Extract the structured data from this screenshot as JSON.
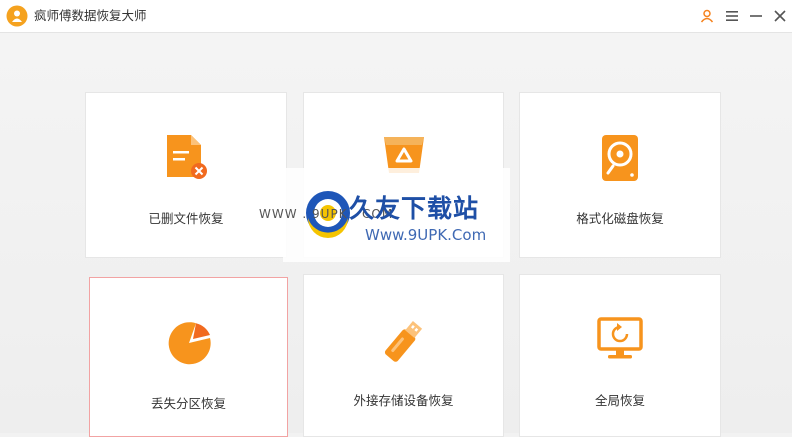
{
  "window": {
    "title": "疯师傅数据恢复大师",
    "accent": "#f5831f",
    "controls": [
      "user-icon",
      "menu-icon",
      "minimize-icon",
      "close-icon"
    ]
  },
  "cards": [
    {
      "label": "已删文件恢复",
      "icon": "deleted-file-icon"
    },
    {
      "label": "",
      "icon": "recycle-bin-icon"
    },
    {
      "label": "格式化磁盘恢复",
      "icon": "formatted-disk-icon"
    },
    {
      "label": "丢失分区恢复",
      "icon": "pie-partition-icon",
      "selected": true
    },
    {
      "label": "外接存储设备恢复",
      "icon": "usb-drive-icon"
    },
    {
      "label": "全局恢复",
      "icon": "monitor-restore-icon"
    }
  ],
  "watermark": {
    "brand": "久友下载站",
    "url": "Www.9UPK.Com",
    "side_text": "WWW . 9UPK . COM"
  }
}
